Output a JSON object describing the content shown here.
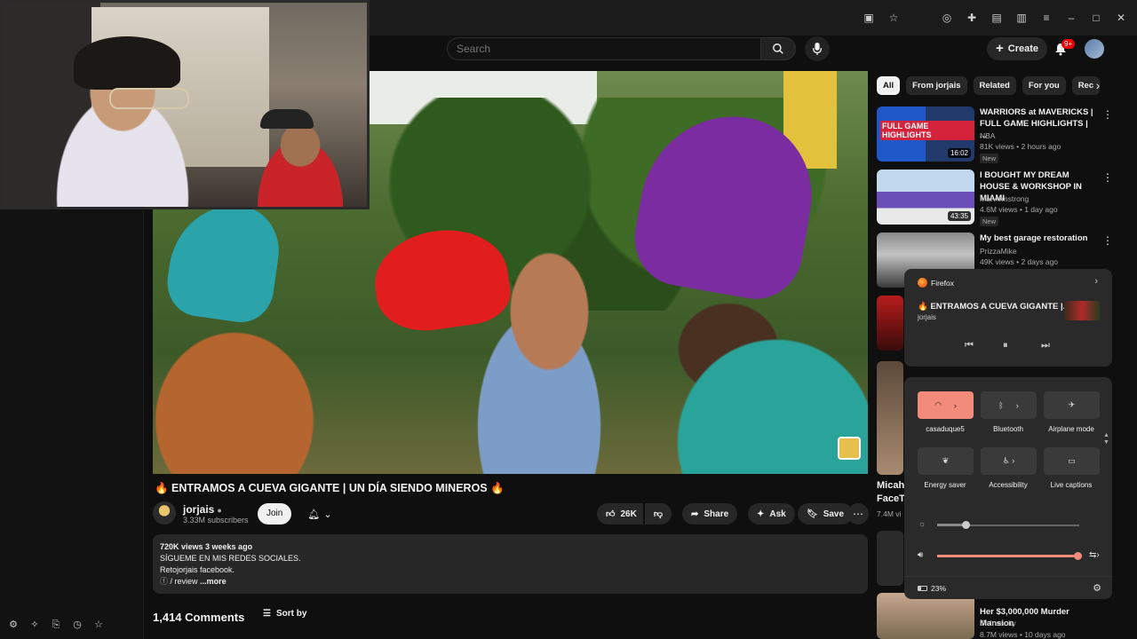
{
  "header": {
    "search_placeholder": "Search",
    "create_label": "Create",
    "notification_badge": "9+"
  },
  "video": {
    "title": "🔥 ENTRAMOS A CUEVA GIGANTE | UN DÍA SIENDO MINEROS 🔥",
    "channel": "jorjais",
    "subscribers": "3.33M subscribers",
    "join_label": "Join",
    "likes": "26K",
    "share_label": "Share",
    "ask_label": "Ask",
    "save_label": "Save"
  },
  "description": {
    "meta": "720K views  3 weeks ago",
    "line1": "SÍGUEME EN MIS REDES SOCIALES.",
    "line2": "Retojorjais facebook.",
    "link": "/ review",
    "more": "...more"
  },
  "comments": {
    "count_label": "1,414 Comments",
    "sort_label": "Sort by"
  },
  "chips": [
    "All",
    "From jorjais",
    "Related",
    "For you",
    "Rec"
  ],
  "recommendations": [
    {
      "title": "WARRIORS at MAVERICKS | FULL GAME HIGHLIGHTS | ...",
      "channel": "NBA",
      "views": "81K views • 2 hours ago",
      "badge": "New",
      "duration": "16:02",
      "thumb_label": "FULL GAME HIGHLIGHTS"
    },
    {
      "title": "I BOUGHT MY DREAM HOUSE & WORKSHOP IN MIAMI",
      "channel": "Mat Armstrong",
      "views": "4.6M views • 1 day ago",
      "badge": "New",
      "duration": "43:35"
    },
    {
      "title": "My best garage restoration",
      "channel": "PrizzaMike",
      "views": "49K views • 2 days ago"
    },
    {
      "title": "Her $3,000,000 Murder Mansion",
      "channel": "Dr Insanity",
      "views": "8.7M views • 10 days ago"
    }
  ],
  "partial_rec": {
    "title_line1": "Micah",
    "title_line2": "FaceTi",
    "views": "7.4M vi"
  },
  "media_popup": {
    "source": "Firefox",
    "title": "🔥 ENTRAMOS A CUEVA GIGANTE |...",
    "artist": "jorjais"
  },
  "quick_settings": {
    "tiles": [
      {
        "label": "casaduque5",
        "on": true
      },
      {
        "label": "Bluetooth",
        "on": false
      },
      {
        "label": "Airplane mode",
        "on": false
      },
      {
        "label": "Energy saver",
        "on": false
      },
      {
        "label": "Accessibility",
        "on": false
      },
      {
        "label": "Live captions",
        "on": false
      }
    ],
    "brightness": 0.2,
    "volume": 0.99,
    "battery": "23%"
  }
}
